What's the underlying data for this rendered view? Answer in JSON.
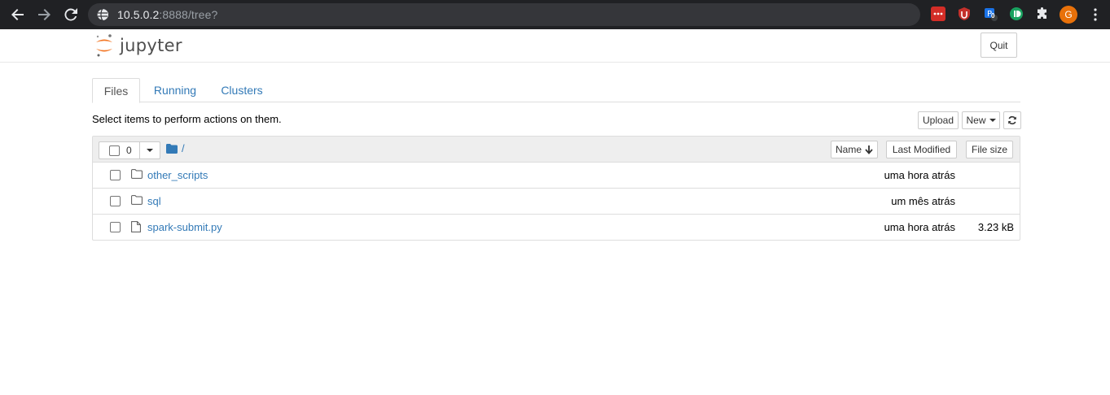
{
  "browser": {
    "url_host": "10.5.0.2",
    "url_rest": ":8888/tree?",
    "avatar_letter": "G",
    "extensions": [
      "lastpass-icon",
      "ublock-icon",
      "proxy-extension-icon",
      "grammar-extension-icon",
      "puzzle-extensions-icon"
    ],
    "ext_badge": "0"
  },
  "header": {
    "logo_text": "jupyter",
    "quit_label": "Quit"
  },
  "tabs": [
    {
      "label": "Files",
      "active": true
    },
    {
      "label": "Running",
      "active": false
    },
    {
      "label": "Clusters",
      "active": false
    }
  ],
  "toolbar": {
    "hint": "Select items to perform actions on them.",
    "upload_label": "Upload",
    "new_label": "New"
  },
  "list": {
    "selected_count": "0",
    "breadcrumb": "/",
    "columns": {
      "name": "Name",
      "last_modified": "Last Modified",
      "file_size": "File size"
    },
    "items": [
      {
        "name": "other_scripts",
        "type": "folder",
        "modified": "uma hora atrás",
        "size": ""
      },
      {
        "name": "sql",
        "type": "folder",
        "modified": "um mês atrás",
        "size": ""
      },
      {
        "name": "spark-submit.py",
        "type": "file",
        "modified": "uma hora atrás",
        "size": "3.23 kB"
      }
    ]
  },
  "colors": {
    "chrome_bg": "#202124",
    "link": "#337ab7",
    "jupyter_orange": "#f37726"
  }
}
